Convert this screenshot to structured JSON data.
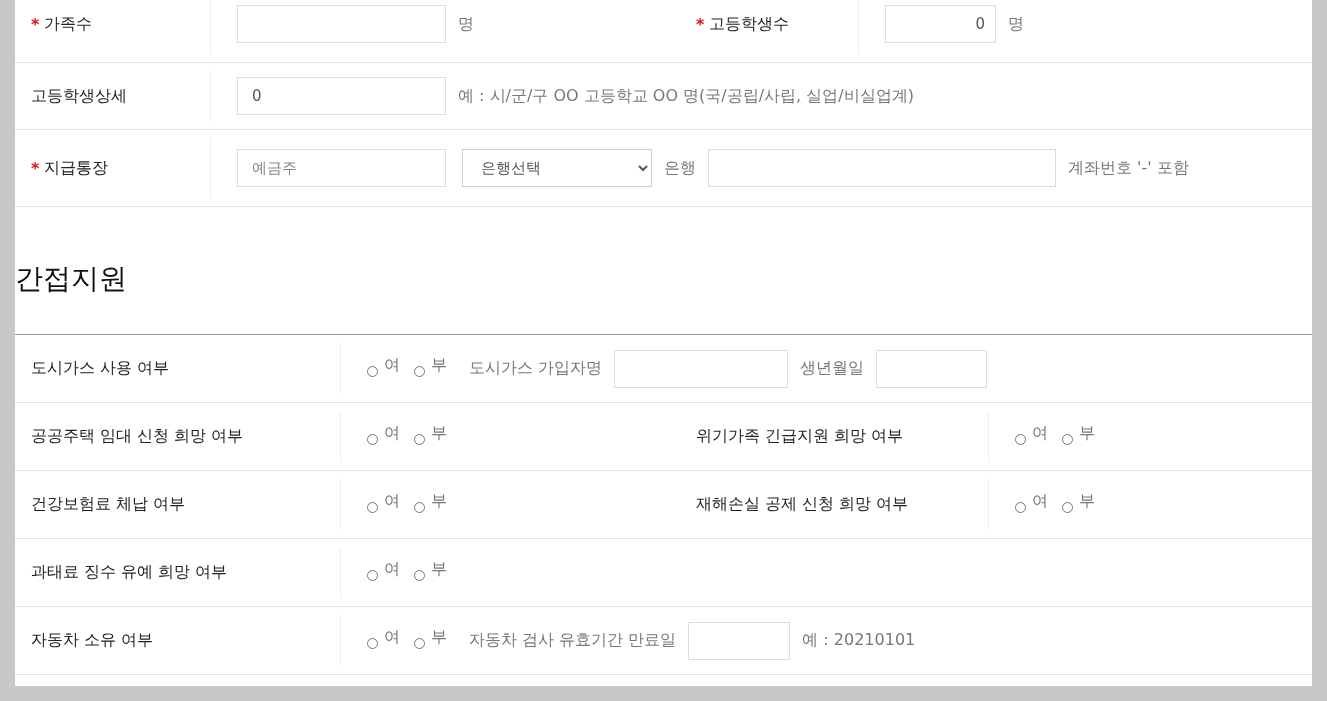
{
  "applicant_section": {
    "rows": [
      {
        "cells": [
          {
            "required_mark": "*",
            "label": "가족수",
            "items": [
              {
                "kind": "input"
              },
              {
                "kind": "text",
                "text": "명"
              }
            ]
          },
          {
            "required_mark": "*",
            "label": "고등학생수",
            "items": [
              {
                "kind": "number",
                "value": "0"
              },
              {
                "kind": "text",
                "text": "명"
              }
            ]
          }
        ]
      },
      {
        "cells": [
          {
            "label": "고등학생상세",
            "items": [
              {
                "kind": "input",
                "value": "0"
              },
              {
                "kind": "text",
                "text": "예 : 시/군/구 OO 고등학교 OO 명(국/공립/사립, 실업/비실업계)"
              }
            ]
          }
        ]
      },
      {
        "cells": [
          {
            "required_mark": "*",
            "label": "지급통장",
            "items": [
              {
                "kind": "input",
                "placeholder": "예금주"
              },
              {
                "kind": "select",
                "value": "은행선택"
              },
              {
                "kind": "text",
                "text": "은행"
              },
              {
                "kind": "input"
              },
              {
                "kind": "text",
                "text": "계좌번호 '-' 포함"
              }
            ]
          }
        ]
      }
    ]
  },
  "indirect_support": {
    "title": "간접지원",
    "rows": [
      {
        "cells": [
          {
            "label": "도시가스 사용 여부",
            "items": [
              {
                "kind": "radio",
                "options": [
                  {
                    "label": "여",
                    "selected": false
                  },
                  {
                    "label": "부",
                    "selected": false
                  }
                ]
              },
              {
                "kind": "text",
                "text": "도시가스 가입자명"
              },
              {
                "kind": "input"
              },
              {
                "kind": "text",
                "text": "생년월일"
              },
              {
                "kind": "input"
              }
            ]
          }
        ]
      },
      {
        "cells": [
          {
            "label": "공공주택 임대 신청 희망 여부",
            "items": [
              {
                "kind": "radio",
                "options": [
                  {
                    "label": "여",
                    "selected": false
                  },
                  {
                    "label": "부",
                    "selected": false
                  }
                ]
              }
            ]
          },
          {
            "label": "위기가족 긴급지원 희망 여부",
            "items": [
              {
                "kind": "radio",
                "options": [
                  {
                    "label": "여",
                    "selected": false
                  },
                  {
                    "label": "부",
                    "selected": false
                  }
                ]
              }
            ]
          }
        ]
      },
      {
        "cells": [
          {
            "label": "건강보험료 체납 여부",
            "items": [
              {
                "kind": "radio",
                "options": [
                  {
                    "label": "여",
                    "selected": false
                  },
                  {
                    "label": "부",
                    "selected": false
                  }
                ]
              }
            ]
          },
          {
            "label": "재해손실 공제 신청 희망 여부",
            "items": [
              {
                "kind": "radio",
                "options": [
                  {
                    "label": "여",
                    "selected": false
                  },
                  {
                    "label": "부",
                    "selected": false
                  }
                ]
              }
            ]
          }
        ]
      },
      {
        "cells": [
          {
            "label": "과태료 징수 유예 희망 여부",
            "items": [
              {
                "kind": "radio",
                "options": [
                  {
                    "label": "여",
                    "selected": false
                  },
                  {
                    "label": "부",
                    "selected": false
                  }
                ]
              }
            ]
          }
        ]
      },
      {
        "cells": [
          {
            "label": "자동차 소유 여부",
            "items": [
              {
                "kind": "radio",
                "options": [
                  {
                    "label": "여",
                    "selected": false
                  },
                  {
                    "label": "부",
                    "selected": false
                  }
                ]
              },
              {
                "kind": "text",
                "text": "자동차 검사 유효기간 만료일"
              },
              {
                "kind": "input"
              },
              {
                "kind": "text",
                "text": "예 : 20210101"
              }
            ]
          }
        ]
      }
    ]
  }
}
